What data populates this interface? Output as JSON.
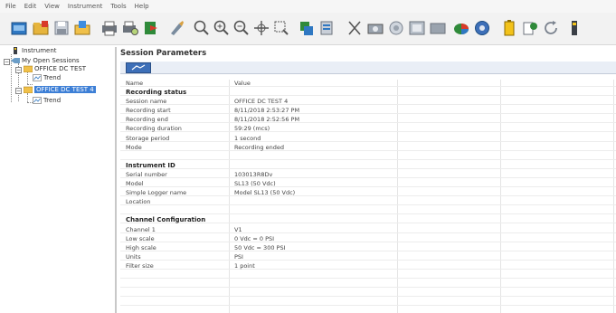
{
  "menu": [
    "File",
    "Edit",
    "View",
    "Instrument",
    "Tools",
    "Help"
  ],
  "toolbar": {
    "buttons": [
      {
        "icon": "new-session-icon"
      },
      {
        "icon": "open-folder-icon"
      },
      {
        "icon": "save-icon"
      },
      {
        "icon": "folder-open-icon"
      },
      {
        "icon": "print-icon"
      },
      {
        "icon": "print-preview-icon"
      },
      {
        "icon": "export-icon"
      },
      {
        "icon": "tools-icon"
      },
      {
        "icon": "zoom-icon"
      },
      {
        "icon": "zoom-in-icon"
      },
      {
        "icon": "zoom-out-icon"
      },
      {
        "icon": "zoom-fit-icon"
      },
      {
        "icon": "zoom-area-icon"
      },
      {
        "icon": "instrument-icon"
      },
      {
        "icon": "instrument-settings-icon"
      },
      {
        "icon": "cut-icon"
      },
      {
        "icon": "camera-icon"
      },
      {
        "icon": "record-icon"
      },
      {
        "icon": "display-icon"
      },
      {
        "icon": "monitor-icon"
      },
      {
        "icon": "chart-icon"
      },
      {
        "icon": "settings-icon"
      },
      {
        "icon": "battery-icon"
      },
      {
        "icon": "report-icon"
      },
      {
        "icon": "refresh-icon"
      },
      {
        "icon": "device-icon"
      }
    ]
  },
  "tree": {
    "instrument": "Instrument",
    "my_open_sessions": "My Open Sessions",
    "session1": "OFFICE DC TEST",
    "session1_trend": "Trend",
    "session2": "OFFICE DC TEST 4",
    "session2_trend": "Trend"
  },
  "main": {
    "title": "Session Parameters",
    "header": {
      "name": "Name",
      "value": "Value"
    },
    "rows": [
      {
        "name": "Recording status",
        "value": "",
        "section": true
      },
      {
        "name": "Session name",
        "value": "OFFICE DC TEST 4"
      },
      {
        "name": "Recording start",
        "value": "8/11/2018 2:53:27 PM"
      },
      {
        "name": "Recording end",
        "value": "8/11/2018 2:52:56 PM"
      },
      {
        "name": "Recording duration",
        "value": "59:29 (mcs)"
      },
      {
        "name": "Storage period",
        "value": "1 second"
      },
      {
        "name": "Mode",
        "value": "Recording ended"
      },
      {
        "name": "",
        "value": ""
      },
      {
        "name": "Instrument ID",
        "value": "",
        "section": true
      },
      {
        "name": "Serial number",
        "value": "103013R8Dv"
      },
      {
        "name": "Model",
        "value": "SL13 (50 Vdc)"
      },
      {
        "name": "Simple Logger name",
        "value": "Model SL13 (50 Vdc)"
      },
      {
        "name": "Location",
        "value": ""
      },
      {
        "name": "",
        "value": ""
      },
      {
        "name": "Channel Configuration",
        "value": "",
        "section": true
      },
      {
        "name": "Channel 1",
        "value": "V1"
      },
      {
        "name": "Low scale",
        "value": "0 Vdc = 0 PSI"
      },
      {
        "name": "High scale",
        "value": "50 Vdc = 300 PSI"
      },
      {
        "name": "Units",
        "value": "PSI"
      },
      {
        "name": "Filter size",
        "value": "1 point"
      }
    ]
  },
  "colors": {
    "selection": "#3d7fd6",
    "tab": "#3d6fb8"
  }
}
